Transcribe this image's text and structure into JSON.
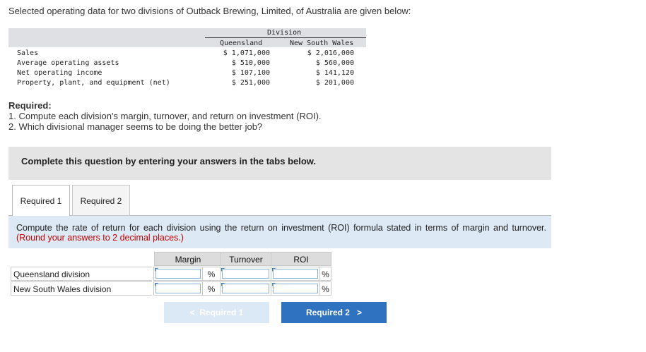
{
  "intro": "Selected operating data for two divisions of Outback Brewing, Limited, of Australia are given below:",
  "data_table": {
    "group_header": "Division",
    "columns": [
      "Queensland",
      "New South Wales"
    ],
    "rows": [
      {
        "label": "Sales",
        "values": [
          "$ 1,071,000",
          "$ 2,016,000"
        ]
      },
      {
        "label": "Average operating assets",
        "values": [
          "$ 510,000",
          "$ 560,000"
        ]
      },
      {
        "label": "Net operating income",
        "values": [
          "$ 107,100",
          "$ 141,120"
        ]
      },
      {
        "label": "Property, plant, and equipment (net)",
        "values": [
          "$ 251,000",
          "$ 201,000"
        ]
      }
    ]
  },
  "required": {
    "heading": "Required:",
    "items": [
      "1. Compute each division's margin, turnover, and return on investment (ROI).",
      "2. Which divisional manager seems to be doing the better job?"
    ]
  },
  "banner": "Complete this question by entering your answers in the tabs below.",
  "tabs": [
    {
      "label": "Required 1",
      "active": true
    },
    {
      "label": "Required 2",
      "active": false
    }
  ],
  "instruction": {
    "text": "Compute the rate of return for each division using the return on investment (ROI) formula stated in terms of margin and turnover.",
    "note": "(Round your answers to 2 decimal places.)"
  },
  "answer_table": {
    "headers": [
      "Margin",
      "Turnover",
      "ROI"
    ],
    "rows": [
      {
        "label": "Queensland division",
        "margin": "",
        "turnover": "",
        "roi": ""
      },
      {
        "label": "New South Wales division",
        "margin": "",
        "turnover": "",
        "roi": ""
      }
    ],
    "percent_symbol": "%"
  },
  "nav": {
    "prev_label": "Required 1",
    "next_label": "Required 2",
    "prev_glyph": "<",
    "next_glyph": ">"
  },
  "colors": {
    "accent": "#2f73c0",
    "instruction_bg": "#dde9f5",
    "note_red": "#cc0000"
  }
}
